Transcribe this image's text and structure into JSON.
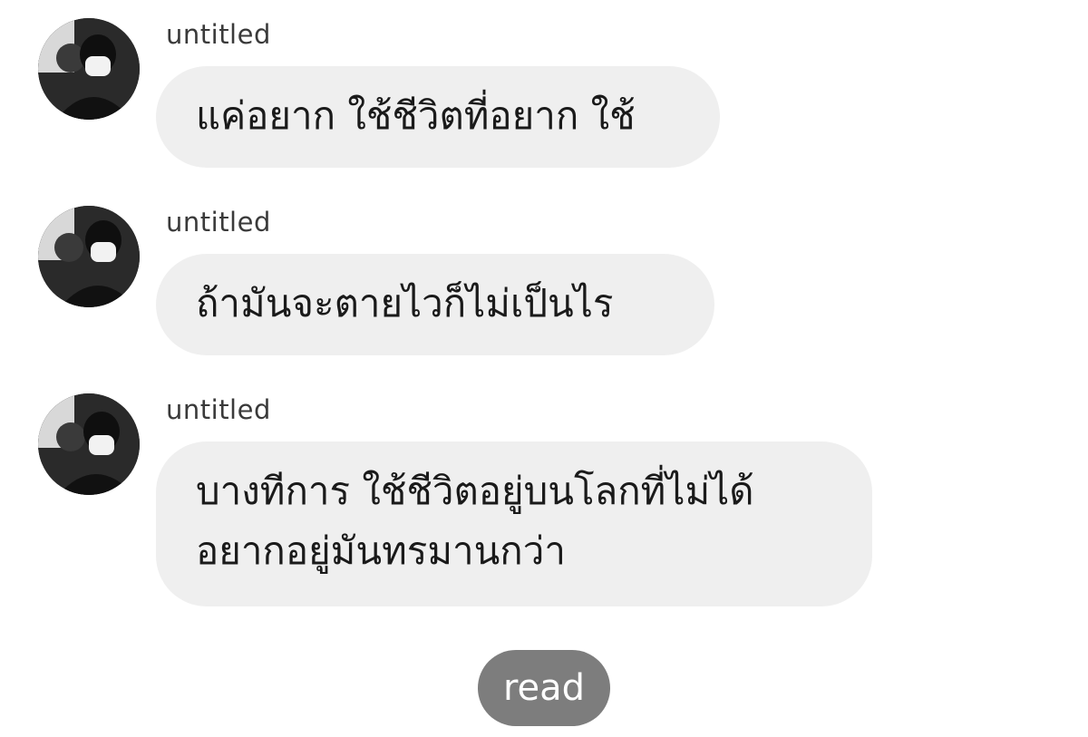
{
  "messages": [
    {
      "sender": "untitled",
      "avatar_icon": "profile-photo",
      "lines": [
        "แค่อยาก ใช้ชีวิตที่อยาก ใช้"
      ]
    },
    {
      "sender": "untitled",
      "avatar_icon": "profile-photo",
      "lines": [
        "ถ้ามันจะตายไวก็ไม่เป็นไร"
      ]
    },
    {
      "sender": "untitled",
      "avatar_icon": "profile-photo",
      "lines": [
        "บางทีการ ใช้ชีวิตอยู่บนโลกที่ไม่ได้",
        "อยากอยู่มันทรมานกว่า"
      ]
    }
  ],
  "status": {
    "read_label": "read"
  },
  "colors": {
    "bubble_background": "#efefef",
    "read_pill_background": "#7d7d7d",
    "page_background": "#ffffff"
  }
}
